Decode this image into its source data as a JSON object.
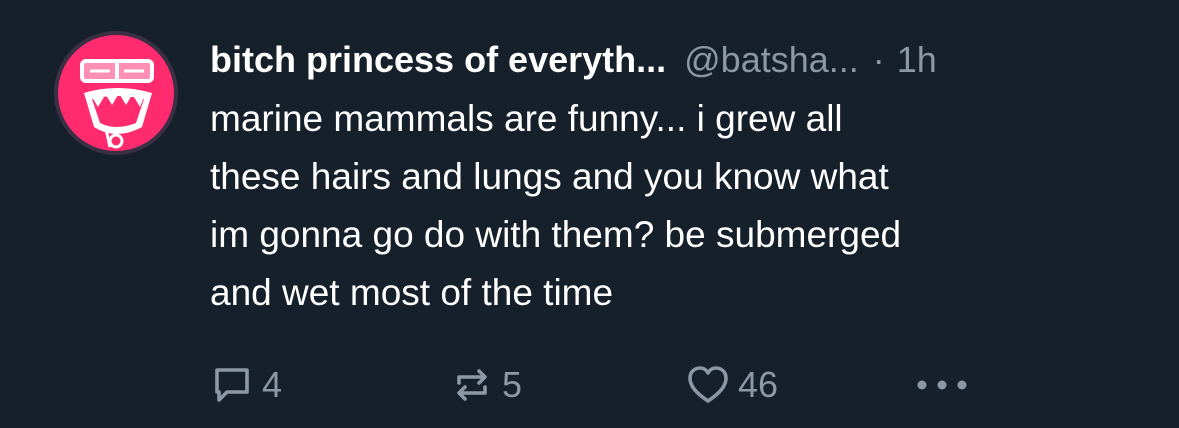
{
  "post": {
    "display_name": "bitch princess of everyth...",
    "handle": "@batsha...",
    "separator": "·",
    "time": "1h",
    "text_lines": [
      "marine mammals are funny... i grew all",
      "these hairs and lungs and you know what",
      "im gonna go do with them? be submerged",
      "and wet most of the time"
    ]
  },
  "actions": {
    "reply_count": "4",
    "repost_count": "5",
    "like_count": "46"
  },
  "icons": {
    "reply": "speech-bubble-icon",
    "repost": "repost-arrows-icon",
    "like": "heart-icon",
    "more": "more-dots-icon"
  },
  "colors": {
    "background": "#15202b",
    "primary_text": "#ffffff",
    "secondary_text": "#8b98a5",
    "avatar_accent": "#ff2b6e"
  }
}
